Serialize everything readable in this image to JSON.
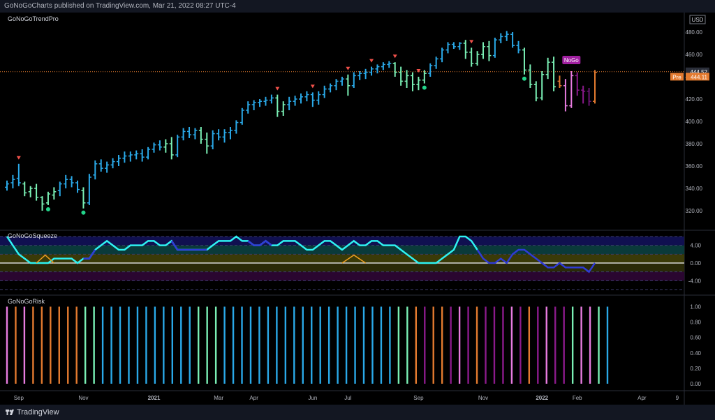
{
  "header": {
    "publish_text": "GoNoGoCharts published on TradingView.com, Mar 21, 2022 08:27 UTC-4"
  },
  "footer": {
    "brand": "TradingView"
  },
  "colors": {
    "bright_blue": "#2aa9e8",
    "light_green": "#7af0b5",
    "orange": "#e37a2f",
    "pink": "#e87ce0",
    "purple": "#8b1a8b",
    "dark_purple": "#6a1574",
    "magenta_label": "#a020a0",
    "squeeze_cyan": "#2ef2f2",
    "squeeze_blue": "#2f3bd6",
    "squeeze_orange": "#f0a020",
    "marker_red": "#f0514a",
    "marker_green": "#22d48a"
  },
  "chart_data": [
    {
      "panel": "price",
      "type": "ohlc",
      "title": "GoNoGoTrendPro",
      "currency": "USD",
      "ylim": [
        310,
        490
      ],
      "y_ticks": [
        320,
        340,
        360,
        380,
        400,
        420,
        440,
        460,
        480
      ],
      "last_price_label": "444.52",
      "premarket": {
        "label": "Pre",
        "value": "444.11"
      },
      "nogo_label": "NoGo",
      "bars": [
        {
          "o": 341,
          "h": 347,
          "l": 338,
          "c": 344,
          "color": "bright_blue"
        },
        {
          "o": 345,
          "h": 352,
          "l": 340,
          "c": 348,
          "color": "bright_blue"
        },
        {
          "o": 349,
          "h": 362,
          "l": 342,
          "c": 345,
          "color": "bright_blue"
        },
        {
          "o": 344,
          "h": 346,
          "l": 333,
          "c": 336,
          "color": "light_green"
        },
        {
          "o": 337,
          "h": 342,
          "l": 332,
          "c": 340,
          "color": "light_green"
        },
        {
          "o": 340,
          "h": 344,
          "l": 329,
          "c": 332,
          "color": "light_green"
        },
        {
          "o": 332,
          "h": 333,
          "l": 320,
          "c": 326,
          "color": "light_green"
        },
        {
          "o": 327,
          "h": 337,
          "l": 325,
          "c": 335,
          "color": "light_green"
        },
        {
          "o": 334,
          "h": 341,
          "l": 330,
          "c": 337,
          "color": "light_green"
        },
        {
          "o": 338,
          "h": 346,
          "l": 333,
          "c": 344,
          "color": "bright_blue"
        },
        {
          "o": 344,
          "h": 352,
          "l": 340,
          "c": 348,
          "color": "bright_blue"
        },
        {
          "o": 348,
          "h": 351,
          "l": 341,
          "c": 345,
          "color": "bright_blue"
        },
        {
          "o": 345,
          "h": 347,
          "l": 336,
          "c": 339,
          "color": "bright_blue"
        },
        {
          "o": 338,
          "h": 341,
          "l": 322,
          "c": 327,
          "color": "light_green"
        },
        {
          "o": 327,
          "h": 353,
          "l": 325,
          "c": 350,
          "color": "bright_blue"
        },
        {
          "o": 352,
          "h": 365,
          "l": 348,
          "c": 362,
          "color": "bright_blue"
        },
        {
          "o": 362,
          "h": 366,
          "l": 355,
          "c": 358,
          "color": "bright_blue"
        },
        {
          "o": 358,
          "h": 364,
          "l": 354,
          "c": 361,
          "color": "bright_blue"
        },
        {
          "o": 361,
          "h": 367,
          "l": 358,
          "c": 364,
          "color": "bright_blue"
        },
        {
          "o": 364,
          "h": 370,
          "l": 360,
          "c": 367,
          "color": "bright_blue"
        },
        {
          "o": 367,
          "h": 373,
          "l": 363,
          "c": 369,
          "color": "bright_blue"
        },
        {
          "o": 369,
          "h": 373,
          "l": 364,
          "c": 370,
          "color": "bright_blue"
        },
        {
          "o": 370,
          "h": 374,
          "l": 366,
          "c": 371,
          "color": "bright_blue"
        },
        {
          "o": 371,
          "h": 375,
          "l": 364,
          "c": 368,
          "color": "bright_blue"
        },
        {
          "o": 368,
          "h": 377,
          "l": 366,
          "c": 375,
          "color": "bright_blue"
        },
        {
          "o": 375,
          "h": 381,
          "l": 372,
          "c": 379,
          "color": "bright_blue"
        },
        {
          "o": 379,
          "h": 383,
          "l": 374,
          "c": 377,
          "color": "bright_blue"
        },
        {
          "o": 377,
          "h": 384,
          "l": 372,
          "c": 380,
          "color": "light_green"
        },
        {
          "o": 380,
          "h": 386,
          "l": 366,
          "c": 370,
          "color": "light_green"
        },
        {
          "o": 370,
          "h": 388,
          "l": 368,
          "c": 386,
          "color": "bright_blue"
        },
        {
          "o": 386,
          "h": 394,
          "l": 383,
          "c": 391,
          "color": "bright_blue"
        },
        {
          "o": 391,
          "h": 395,
          "l": 385,
          "c": 388,
          "color": "bright_blue"
        },
        {
          "o": 388,
          "h": 394,
          "l": 384,
          "c": 392,
          "color": "bright_blue"
        },
        {
          "o": 392,
          "h": 395,
          "l": 380,
          "c": 384,
          "color": "light_green"
        },
        {
          "o": 384,
          "h": 390,
          "l": 371,
          "c": 378,
          "color": "light_green"
        },
        {
          "o": 378,
          "h": 392,
          "l": 375,
          "c": 389,
          "color": "bright_blue"
        },
        {
          "o": 389,
          "h": 393,
          "l": 383,
          "c": 386,
          "color": "bright_blue"
        },
        {
          "o": 386,
          "h": 393,
          "l": 381,
          "c": 390,
          "color": "bright_blue"
        },
        {
          "o": 390,
          "h": 395,
          "l": 384,
          "c": 392,
          "color": "bright_blue"
        },
        {
          "o": 392,
          "h": 401,
          "l": 389,
          "c": 399,
          "color": "bright_blue"
        },
        {
          "o": 399,
          "h": 412,
          "l": 397,
          "c": 410,
          "color": "bright_blue"
        },
        {
          "o": 410,
          "h": 418,
          "l": 407,
          "c": 415,
          "color": "bright_blue"
        },
        {
          "o": 415,
          "h": 419,
          "l": 410,
          "c": 417,
          "color": "bright_blue"
        },
        {
          "o": 417,
          "h": 420,
          "l": 413,
          "c": 418,
          "color": "bright_blue"
        },
        {
          "o": 418,
          "h": 422,
          "l": 414,
          "c": 419,
          "color": "bright_blue"
        },
        {
          "o": 419,
          "h": 424,
          "l": 416,
          "c": 421,
          "color": "bright_blue"
        },
        {
          "o": 421,
          "h": 424,
          "l": 404,
          "c": 409,
          "color": "light_green"
        },
        {
          "o": 409,
          "h": 418,
          "l": 405,
          "c": 415,
          "color": "light_green"
        },
        {
          "o": 415,
          "h": 422,
          "l": 410,
          "c": 418,
          "color": "bright_blue"
        },
        {
          "o": 418,
          "h": 423,
          "l": 414,
          "c": 420,
          "color": "bright_blue"
        },
        {
          "o": 420,
          "h": 425,
          "l": 416,
          "c": 422,
          "color": "bright_blue"
        },
        {
          "o": 422,
          "h": 427,
          "l": 418,
          "c": 424,
          "color": "bright_blue"
        },
        {
          "o": 424,
          "h": 426,
          "l": 413,
          "c": 419,
          "color": "bright_blue"
        },
        {
          "o": 419,
          "h": 427,
          "l": 415,
          "c": 424,
          "color": "bright_blue"
        },
        {
          "o": 424,
          "h": 432,
          "l": 421,
          "c": 429,
          "color": "bright_blue"
        },
        {
          "o": 429,
          "h": 434,
          "l": 426,
          "c": 432,
          "color": "bright_blue"
        },
        {
          "o": 432,
          "h": 438,
          "l": 428,
          "c": 436,
          "color": "bright_blue"
        },
        {
          "o": 436,
          "h": 440,
          "l": 432,
          "c": 438,
          "color": "bright_blue"
        },
        {
          "o": 438,
          "h": 442,
          "l": 423,
          "c": 432,
          "color": "light_green"
        },
        {
          "o": 432,
          "h": 444,
          "l": 430,
          "c": 441,
          "color": "bright_blue"
        },
        {
          "o": 441,
          "h": 445,
          "l": 437,
          "c": 443,
          "color": "bright_blue"
        },
        {
          "o": 443,
          "h": 447,
          "l": 438,
          "c": 444,
          "color": "bright_blue"
        },
        {
          "o": 444,
          "h": 449,
          "l": 441,
          "c": 447,
          "color": "bright_blue"
        },
        {
          "o": 447,
          "h": 451,
          "l": 443,
          "c": 449,
          "color": "bright_blue"
        },
        {
          "o": 449,
          "h": 453,
          "l": 446,
          "c": 451,
          "color": "bright_blue"
        },
        {
          "o": 451,
          "h": 454,
          "l": 448,
          "c": 452,
          "color": "bright_blue"
        },
        {
          "o": 452,
          "h": 453,
          "l": 440,
          "c": 444,
          "color": "light_green"
        },
        {
          "o": 444,
          "h": 449,
          "l": 432,
          "c": 436,
          "color": "light_green"
        },
        {
          "o": 436,
          "h": 446,
          "l": 430,
          "c": 441,
          "color": "light_green"
        },
        {
          "o": 441,
          "h": 444,
          "l": 427,
          "c": 433,
          "color": "light_green"
        },
        {
          "o": 433,
          "h": 440,
          "l": 428,
          "c": 437,
          "color": "light_green"
        },
        {
          "o": 437,
          "h": 446,
          "l": 434,
          "c": 443,
          "color": "light_green"
        },
        {
          "o": 443,
          "h": 452,
          "l": 440,
          "c": 450,
          "color": "bright_blue"
        },
        {
          "o": 450,
          "h": 458,
          "l": 447,
          "c": 456,
          "color": "bright_blue"
        },
        {
          "o": 456,
          "h": 466,
          "l": 453,
          "c": 464,
          "color": "bright_blue"
        },
        {
          "o": 464,
          "h": 471,
          "l": 461,
          "c": 469,
          "color": "bright_blue"
        },
        {
          "o": 469,
          "h": 471,
          "l": 465,
          "c": 467,
          "color": "bright_blue"
        },
        {
          "o": 467,
          "h": 471,
          "l": 464,
          "c": 470,
          "color": "bright_blue"
        },
        {
          "o": 470,
          "h": 473,
          "l": 456,
          "c": 462,
          "color": "light_green"
        },
        {
          "o": 462,
          "h": 466,
          "l": 449,
          "c": 452,
          "color": "light_green"
        },
        {
          "o": 452,
          "h": 463,
          "l": 450,
          "c": 460,
          "color": "light_green"
        },
        {
          "o": 460,
          "h": 471,
          "l": 456,
          "c": 467,
          "color": "light_green"
        },
        {
          "o": 467,
          "h": 472,
          "l": 454,
          "c": 459,
          "color": "light_green"
        },
        {
          "o": 459,
          "h": 475,
          "l": 457,
          "c": 473,
          "color": "bright_blue"
        },
        {
          "o": 473,
          "h": 479,
          "l": 470,
          "c": 476,
          "color": "bright_blue"
        },
        {
          "o": 476,
          "h": 481,
          "l": 472,
          "c": 478,
          "color": "bright_blue"
        },
        {
          "o": 478,
          "h": 480,
          "l": 466,
          "c": 468,
          "color": "bright_blue"
        },
        {
          "o": 468,
          "h": 472,
          "l": 461,
          "c": 464,
          "color": "bright_blue"
        },
        {
          "o": 464,
          "h": 466,
          "l": 442,
          "c": 446,
          "color": "light_green"
        },
        {
          "o": 446,
          "h": 451,
          "l": 430,
          "c": 433,
          "color": "light_green"
        },
        {
          "o": 433,
          "h": 436,
          "l": 418,
          "c": 421,
          "color": "light_green"
        },
        {
          "o": 421,
          "h": 445,
          "l": 419,
          "c": 442,
          "color": "light_green"
        },
        {
          "o": 442,
          "h": 457,
          "l": 438,
          "c": 453,
          "color": "light_green"
        },
        {
          "o": 453,
          "h": 458,
          "l": 427,
          "c": 431,
          "color": "light_green"
        },
        {
          "o": 436,
          "h": 441,
          "l": 430,
          "c": 432,
          "color": "orange"
        },
        {
          "o": 432,
          "h": 438,
          "l": 409,
          "c": 414,
          "color": "pink"
        },
        {
          "o": 414,
          "h": 445,
          "l": 412,
          "c": 441,
          "color": "pink"
        },
        {
          "o": 441,
          "h": 444,
          "l": 423,
          "c": 428,
          "color": "purple"
        },
        {
          "o": 428,
          "h": 432,
          "l": 416,
          "c": 427,
          "color": "purple"
        },
        {
          "o": 427,
          "h": 430,
          "l": 414,
          "c": 418,
          "color": "dark_purple"
        },
        {
          "o": 418,
          "h": 446,
          "l": 416,
          "c": 444,
          "color": "orange"
        }
      ],
      "red_markers_at_bars": [
        2,
        46,
        52,
        58,
        62,
        66,
        70,
        79
      ],
      "green_markers_at_bars": [
        7,
        13,
        71,
        88
      ]
    },
    {
      "panel": "squeeze",
      "type": "line",
      "title": "GoNoGoSqueeze",
      "ylim": [
        -6,
        6
      ],
      "y_ticks": [
        4.0,
        0.0,
        -4.0
      ],
      "y_tick_labels": [
        "4.00",
        "0.00",
        "-4.00"
      ],
      "values": [
        6,
        4,
        2,
        1,
        0,
        0,
        0,
        0,
        1,
        1,
        1,
        1,
        0,
        1,
        1,
        3,
        4,
        5,
        4,
        3,
        3,
        4,
        4,
        4,
        5,
        5,
        4,
        4,
        5,
        3,
        3,
        3,
        3,
        3,
        3,
        4,
        5,
        5,
        5,
        6,
        5,
        5,
        4,
        4,
        5,
        4,
        4,
        5,
        5,
        5,
        4,
        3,
        3,
        4,
        5,
        5,
        4,
        3,
        4,
        5,
        4,
        4,
        5,
        5,
        4,
        4,
        4,
        3,
        2,
        1,
        0,
        0,
        0,
        0,
        1,
        2,
        3,
        6,
        6,
        5,
        3,
        1,
        0,
        0,
        1,
        0,
        2,
        3,
        3,
        2,
        1,
        0,
        -1,
        -1,
        0,
        -1,
        -1,
        -1,
        -1,
        -2,
        0
      ],
      "colors_by_segment": "cyan_first_half_blue_second",
      "orange_wave_ranges": [
        [
          5,
          8
        ],
        [
          57,
          61
        ]
      ]
    },
    {
      "panel": "risk",
      "type": "bar",
      "title": "GoNoGoRisk",
      "ylim": [
        0,
        1.05
      ],
      "y_ticks": [
        1.0,
        0.8,
        0.6,
        0.4,
        0.2,
        0.0
      ],
      "y_tick_labels": [
        "1.00",
        "0.80",
        "0.60",
        "0.40",
        "0.20",
        "0.00"
      ],
      "value": 1.0,
      "bar_colors": [
        "pink",
        "orange",
        "pink",
        "orange",
        "orange",
        "orange",
        "orange",
        "orange",
        "orange",
        "light_green",
        "light_green",
        "bright_blue",
        "bright_blue",
        "bright_blue",
        "bright_blue",
        "bright_blue",
        "bright_blue",
        "bright_blue",
        "bright_blue",
        "bright_blue",
        "bright_blue",
        "bright_blue",
        "light_green",
        "light_green",
        "light_green",
        "bright_blue",
        "bright_blue",
        "bright_blue",
        "bright_blue",
        "bright_blue",
        "bright_blue",
        "bright_blue",
        "bright_blue",
        "bright_blue",
        "bright_blue",
        "bright_blue",
        "bright_blue",
        "bright_blue",
        "bright_blue",
        "bright_blue",
        "bright_blue",
        "bright_blue",
        "bright_blue",
        "bright_blue",
        "bright_blue",
        "light_green",
        "light_green",
        "orange",
        "purple",
        "orange",
        "orange",
        "purple",
        "pink",
        "purple",
        "orange",
        "purple",
        "purple",
        "purple",
        "pink",
        "purple",
        "orange",
        "purple",
        "pink",
        "purple",
        "purple",
        "light_green",
        "pink",
        "pink",
        "light_green",
        "bright_blue"
      ]
    }
  ],
  "x_axis": {
    "labels": [
      "Sep",
      "Nov",
      "2021",
      "Mar",
      "Apr",
      "Jun",
      "Jul",
      "Sep",
      "Nov",
      "2022",
      "Feb",
      "Apr",
      "9"
    ],
    "label_positions_bar_index": [
      2,
      13,
      25,
      36,
      42,
      52,
      58,
      70,
      81,
      91,
      97,
      108,
      114
    ]
  }
}
